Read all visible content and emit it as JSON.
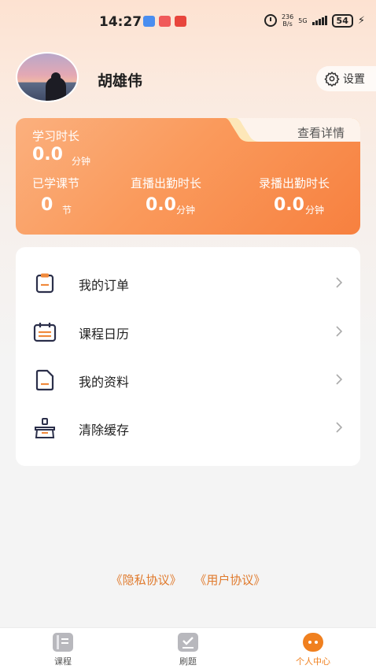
{
  "status_bar": {
    "time": "14:27",
    "net_speed_value": "236",
    "net_speed_unit": "B/s",
    "network": "5G",
    "battery": "54"
  },
  "profile": {
    "user_name": "胡雄伟",
    "settings_label": "设置"
  },
  "study_card": {
    "study_time_label": "学习时长",
    "study_time_value": "0.0",
    "study_time_unit": "分钟",
    "detail_label": "查看详情",
    "lessons_label": "已学课节",
    "lessons_value": "0",
    "lessons_unit": "节",
    "live_label": "直播出勤时长",
    "live_value": "0.0",
    "live_unit": "分钟",
    "recorded_label": "录播出勤时长",
    "recorded_value": "0.0",
    "recorded_unit": "分钟"
  },
  "menu": {
    "items": [
      {
        "label": "我的订单",
        "icon": "order-icon"
      },
      {
        "label": "课程日历",
        "icon": "calendar-icon"
      },
      {
        "label": "我的资料",
        "icon": "document-icon"
      },
      {
        "label": "清除缓存",
        "icon": "broom-icon"
      }
    ]
  },
  "agreements": {
    "privacy": "《隐私协议》",
    "user": "《用户协议》"
  },
  "tab_bar": {
    "tabs": [
      {
        "label": "课程",
        "icon": "course-icon"
      },
      {
        "label": "刷题",
        "icon": "practice-icon"
      },
      {
        "label": "个人中心",
        "icon": "profile-icon"
      }
    ],
    "active_color": "#f0801f"
  },
  "colors": {
    "accent": "#f7803f",
    "link": "#e07a2c"
  }
}
